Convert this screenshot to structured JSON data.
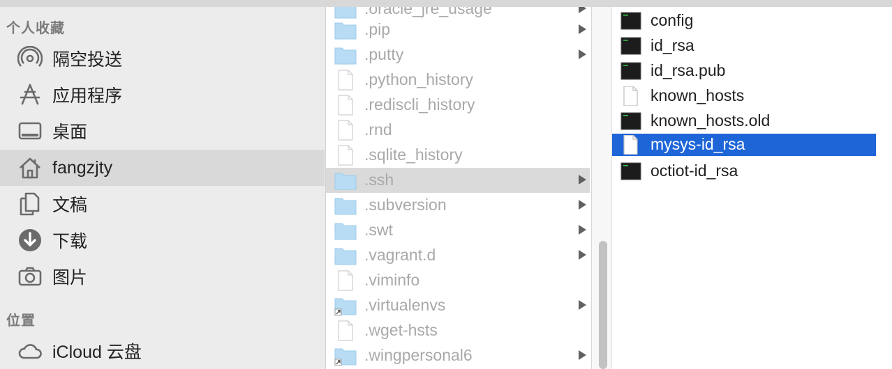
{
  "sidebar": {
    "favorites_header": "个人收藏",
    "locations_header": "位置",
    "items": [
      {
        "label": "隔空投送",
        "icon": "airdrop-icon"
      },
      {
        "label": "应用程序",
        "icon": "applications-icon"
      },
      {
        "label": "桌面",
        "icon": "desktop-icon"
      },
      {
        "label": "fangzjty",
        "icon": "home-icon"
      },
      {
        "label": "文稿",
        "icon": "documents-icon"
      },
      {
        "label": "下载",
        "icon": "downloads-icon"
      },
      {
        "label": "图片",
        "icon": "camera-icon"
      }
    ],
    "locations": [
      {
        "label": "iCloud 云盘",
        "icon": "cloud-icon"
      }
    ],
    "selected": "fangzjty"
  },
  "column2": {
    "items": [
      {
        "name": ".oracle_jre_usage",
        "kind": "folder"
      },
      {
        "name": ".pip",
        "kind": "folder"
      },
      {
        "name": ".putty",
        "kind": "folder"
      },
      {
        "name": ".python_history",
        "kind": "file"
      },
      {
        "name": ".rediscli_history",
        "kind": "file"
      },
      {
        "name": ".rnd",
        "kind": "file"
      },
      {
        "name": ".sqlite_history",
        "kind": "file"
      },
      {
        "name": ".ssh",
        "kind": "folder"
      },
      {
        "name": ".subversion",
        "kind": "folder"
      },
      {
        "name": ".swt",
        "kind": "folder"
      },
      {
        "name": ".vagrant.d",
        "kind": "folder"
      },
      {
        "name": ".viminfo",
        "kind": "file"
      },
      {
        "name": ".virtualenvs",
        "kind": "alias-folder"
      },
      {
        "name": ".wget-hsts",
        "kind": "file"
      },
      {
        "name": ".wingpersonal6",
        "kind": "alias-folder"
      }
    ],
    "selected": ".ssh"
  },
  "column3": {
    "items": [
      {
        "name": "config",
        "kind": "exec"
      },
      {
        "name": "id_rsa",
        "kind": "exec"
      },
      {
        "name": "id_rsa.pub",
        "kind": "exec"
      },
      {
        "name": "known_hosts",
        "kind": "file"
      },
      {
        "name": "known_hosts.old",
        "kind": "exec"
      },
      {
        "name": "mysys-id_rsa",
        "kind": "file"
      },
      {
        "name": "octiot-id_rsa",
        "kind": "exec"
      }
    ],
    "selected": "mysys-id_rsa"
  },
  "colors": {
    "sidebar_bg": "#ececec",
    "selection_blue": "#1e65d8",
    "selection_gray": "#dadada",
    "folder_blue": "#b8dcf4",
    "dim_text": "#a9a9a9"
  }
}
